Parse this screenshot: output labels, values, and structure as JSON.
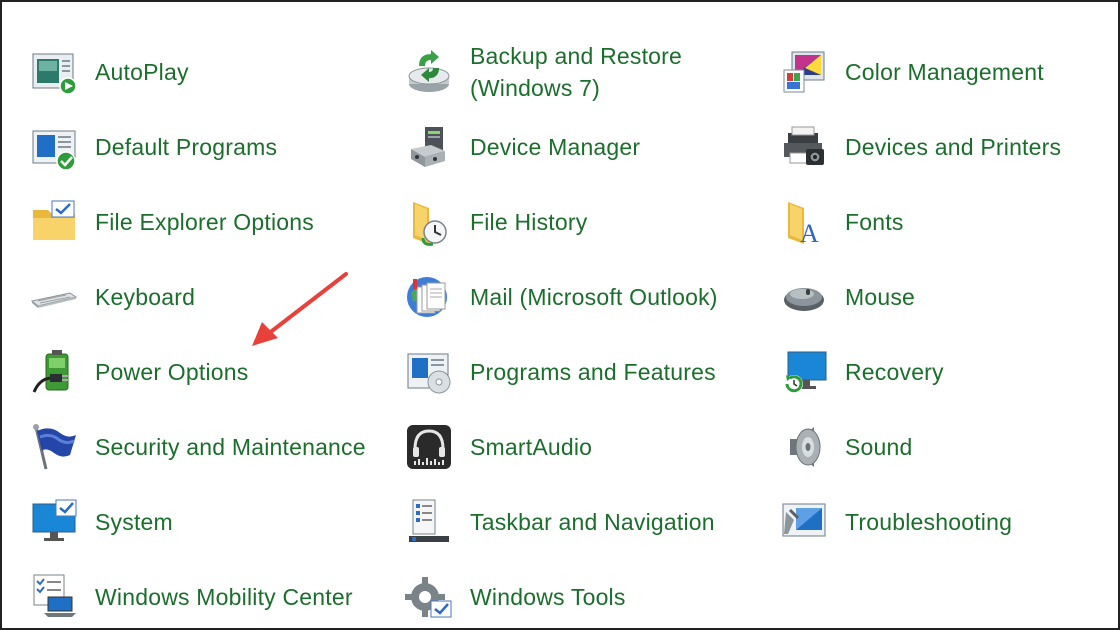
{
  "items": [
    {
      "label": "AutoPlay",
      "icon": "autoplay-icon"
    },
    {
      "label": "Backup and Restore\n(Windows 7)",
      "icon": "backup-restore-icon"
    },
    {
      "label": "Color Management",
      "icon": "color-management-icon"
    },
    {
      "label": "Default Programs",
      "icon": "default-programs-icon"
    },
    {
      "label": "Device Manager",
      "icon": "device-manager-icon"
    },
    {
      "label": "Devices and Printers",
      "icon": "devices-printers-icon"
    },
    {
      "label": "File Explorer Options",
      "icon": "file-explorer-options-icon"
    },
    {
      "label": "File History",
      "icon": "file-history-icon"
    },
    {
      "label": "Fonts",
      "icon": "fonts-icon"
    },
    {
      "label": "Keyboard",
      "icon": "keyboard-icon"
    },
    {
      "label": "Mail (Microsoft Outlook)",
      "icon": "mail-icon"
    },
    {
      "label": "Mouse",
      "icon": "mouse-icon"
    },
    {
      "label": "Power Options",
      "icon": "power-options-icon"
    },
    {
      "label": "Programs and Features",
      "icon": "programs-features-icon"
    },
    {
      "label": "Recovery",
      "icon": "recovery-icon"
    },
    {
      "label": "Security and Maintenance",
      "icon": "security-maintenance-icon"
    },
    {
      "label": "SmartAudio",
      "icon": "smartaudio-icon"
    },
    {
      "label": "Sound",
      "icon": "sound-icon"
    },
    {
      "label": "System",
      "icon": "system-icon"
    },
    {
      "label": "Taskbar and Navigation",
      "icon": "taskbar-navigation-icon"
    },
    {
      "label": "Troubleshooting",
      "icon": "troubleshooting-icon"
    },
    {
      "label": "Windows Mobility Center",
      "icon": "windows-mobility-center-icon"
    },
    {
      "label": "Windows Tools",
      "icon": "windows-tools-icon"
    }
  ],
  "colors": {
    "link": "#1b6e2c",
    "annotation_arrow": "#e8413a"
  }
}
